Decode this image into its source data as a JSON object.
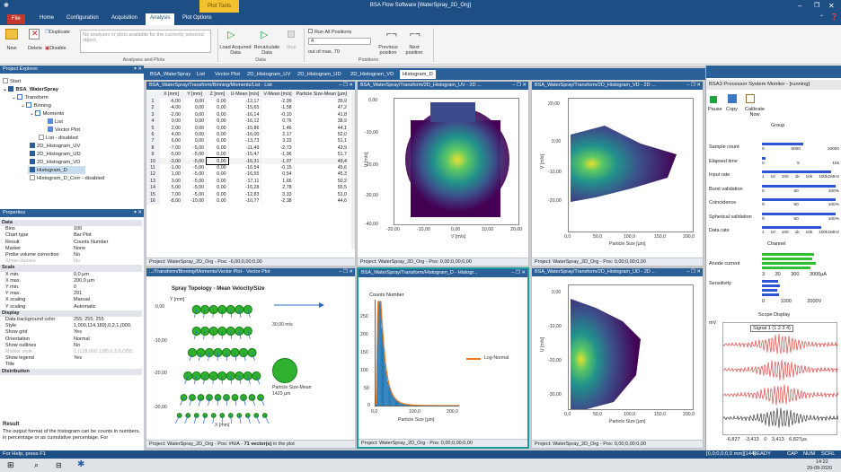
{
  "title": {
    "app": "BSA Flow Software [WaterSpray_2D_Org]",
    "context_tab": "Plot Tools"
  },
  "tabs": [
    "File",
    "Home",
    "Configuration",
    "Acquisition",
    "Analysis",
    "Plot Options"
  ],
  "ribbon": {
    "copy": "Copy",
    "duplicate": "Duplicate",
    "new": "New",
    "delete": "Delete",
    "disable": "Disable",
    "info": "No analyses or plots available for the currently selected object.",
    "group_analyses": "Analyses and Plots",
    "load": "Load Acquired Data",
    "recalc": "Recalculate Data",
    "stop": "Stop",
    "run_all": "Run All Positions",
    "position_value": "4",
    "out_of": "out of max. 70",
    "previous": "Previous position",
    "next": "Next position",
    "group_data": "Data",
    "group_positions": "Positions"
  },
  "explorer": {
    "title": "Project Explorer",
    "items": [
      "Start",
      "BSA_WaterSpray",
      "Transform",
      "Binning",
      "Moments",
      "List",
      "Vector Plot",
      "List - disabled",
      "2D_Histogram_UV",
      "2D_Histogram_UD",
      "2D_Histogram_VD",
      "Histogram_D",
      "Histogram_D_Corr - disabled"
    ]
  },
  "properties": {
    "title": "Properties",
    "rows": [
      {
        "c": 1,
        "k": "Data"
      },
      {
        "k": "Bins",
        "v": "100"
      },
      {
        "k": "Chart type",
        "v": "Bar Plot"
      },
      {
        "k": "Result",
        "v": "Counts Number"
      },
      {
        "k": "Marker",
        "v": "None"
      },
      {
        "k": "Probe volume correction",
        "v": "No"
      },
      {
        "d": 1,
        "k": "Show classes",
        "v": "No"
      },
      {
        "c": 1,
        "k": "Scale"
      },
      {
        "k": "X min.",
        "v": "0,0 µm"
      },
      {
        "k": "X max.",
        "v": "200,0 µm"
      },
      {
        "k": "Y min.",
        "v": "0"
      },
      {
        "k": "Y max.",
        "v": "291"
      },
      {
        "k": "X scaling",
        "v": "Manual"
      },
      {
        "k": "Y scaling",
        "v": "Automatic"
      },
      {
        "c": 1,
        "k": "Display"
      },
      {
        "k": "Data background color",
        "v": "255; 255; 255"
      },
      {
        "k": "Style",
        "v": "1,000,114,189),0,2,1,(000,"
      },
      {
        "k": "Show grid",
        "v": "Yes"
      },
      {
        "k": "Orientation",
        "v": "Normal"
      },
      {
        "k": "Show outlines",
        "v": "No"
      },
      {
        "d": 1,
        "k": "Marker style",
        "v": "1,(128,000,128),0,3,5,(255,"
      },
      {
        "k": "Show legend",
        "v": "Yes"
      },
      {
        "k": "Title",
        "v": ""
      },
      {
        "c": 1,
        "k": "Distribution"
      }
    ],
    "result_title": "Result",
    "result_text": "The output format of the histogram can be counts in numbers, in percentage or as cumulative percentage. For"
  },
  "doc_tabs": [
    "BSA_WaterSpray",
    "List",
    "Vector Plot",
    "2D_Histogram_UV",
    "2D_Histogram_UD",
    "2D_Histogram_VD",
    "Histogram_D"
  ],
  "list_pane": {
    "title": "BSA_WaterSpray/Transform/Binning/Moments/List - List",
    "headers": [
      "",
      "X [mm]",
      "Y [mm]",
      "Z [mm]",
      "U-Mean [m/s]",
      "V-Mean [m/s]",
      "Particle Size-Mean [µm]"
    ],
    "rows": [
      [
        "1",
        "-6,00",
        "0,00",
        "0,00",
        "-12,17",
        "-2,99",
        "39,9"
      ],
      [
        "2",
        "-4,00",
        "0,00",
        "0,00",
        "-15,65",
        "-1,58",
        "47,2"
      ],
      [
        "3",
        "-2,00",
        "0,00",
        "0,00",
        "-16,14",
        "-0,10",
        "41,8"
      ],
      [
        "4",
        "0,00",
        "0,00",
        "0,00",
        "-16,12",
        "0,76",
        "38,9"
      ],
      [
        "5",
        "2,00",
        "0,00",
        "0,00",
        "-15,86",
        "1,46",
        "44,1"
      ],
      [
        "6",
        "4,00",
        "0,00",
        "0,00",
        "-16,00",
        "2,17",
        "52,0"
      ],
      [
        "7",
        "6,00",
        "0,00",
        "0,00",
        "-13,73",
        "3,33",
        "51,1"
      ],
      [
        "8",
        "-7,00",
        "-5,00",
        "0,00",
        "-11,49",
        "-2,73",
        "43,9"
      ],
      [
        "9",
        "-5,00",
        "-5,00",
        "0,00",
        "-15,47",
        "-1,96",
        "51,7"
      ],
      [
        "10",
        "-3,00",
        "-5,00",
        "0,00",
        "-16,31",
        "-1,07",
        "49,4"
      ],
      [
        "11",
        "-1,00",
        "-5,00",
        "0,00",
        "-16,54",
        "-0,15",
        "45,6"
      ],
      [
        "12",
        "1,00",
        "-5,00",
        "0,00",
        "-16,55",
        "0,54",
        "45,3"
      ],
      [
        "13",
        "3,00",
        "-5,00",
        "0,00",
        "-17,11",
        "1,66",
        "50,2"
      ],
      [
        "14",
        "5,00",
        "-5,00",
        "0,00",
        "-16,28",
        "2,78",
        "55,5"
      ],
      [
        "15",
        "7,00",
        "-5,00",
        "0,00",
        "-12,83",
        "3,33",
        "51,0"
      ],
      [
        "16",
        "-8,00",
        "-10,00",
        "0,00",
        "-10,77",
        "-2,38",
        "44,6"
      ]
    ],
    "status": "Project: WaterSpray_2D_Org - Pos: -6,00;0,00;0,00"
  },
  "uv_pane": {
    "title": "BSA_WaterSpray/Transform/2D_Histogram_UV - 2D ...",
    "ylabel": "U [m/s]",
    "xlabel": "V [m/s]",
    "yticks": [
      "0,00",
      "-10,00",
      "-20,00",
      "-30,00",
      "-40,00"
    ],
    "xticks": [
      "-20,00",
      "-10,00",
      "0,00",
      "10,00",
      "20,00"
    ],
    "status": "Project: WaterSpray_2D_Org - Pos: 0,00;0,00;0,00"
  },
  "vd_pane": {
    "title": "BSA_WaterSpray/Transform/2D_Histogram_VD - 2D ...",
    "ylabel": "V [m/s]",
    "xlabel": "Particle Size [µm]",
    "yticks": [
      "20,00",
      "0,00",
      "-10,00",
      "-20,00"
    ],
    "xticks": [
      "0,0",
      "50,0",
      "100,0",
      "150,0",
      "200,0"
    ],
    "status": "Project: WaterSpray_2D_Org - Pos: 0,00;0,00;0,00"
  },
  "vector_pane": {
    "title": ".../Transform/Binning/Moments/Vector Plot - Vector Plot",
    "chart_title": "Spray Topology - Mean Velocity/Size",
    "ylabel": "Y [mm]",
    "yticks": [
      "0,00",
      "-10,00",
      "-20,00",
      "-30,00"
    ],
    "xlabel": "X [mm]",
    "ref_speed": "30,00 m/s",
    "size_label": "Particle Size-Mean",
    "size_value": "1420 µm",
    "status_prefix": "Project: WaterSpray_2D_Org - Pos: #N/A - ",
    "status_bold": "71 vector(s)",
    "status_suffix": " in the plot"
  },
  "hist_pane": {
    "title": "BSA_WaterSpray/Transform/Histogram_D - Histogr...",
    "chart_title": "Counts Number",
    "legend": "Log-Normal",
    "xlabel": "Particle Size [µm]",
    "yticks": [
      "250",
      "200",
      "150",
      "100",
      "50",
      "0"
    ],
    "xticks": [
      "0,0",
      "100,0",
      "200,0"
    ],
    "status": "Project: WaterSpray_2D_Org - Pos: 0,00;0,00;0,00"
  },
  "ud_pane": {
    "title": "BSA_WaterSpray/Transform/2D_Histogram_UD - 2D ...",
    "ylabel": "U [m/s]",
    "xlabel": "Particle Size [µm]",
    "yticks": [
      "0,00",
      "-10,00",
      "-20,00",
      "-30,00"
    ],
    "xticks": [
      "0,0",
      "50,0",
      "100,0",
      "150,0",
      "200,0"
    ],
    "status": "Project: WaterSpray_2D_Org - Pos: 0,00;0,00;0,00"
  },
  "monitor": {
    "title": "BSA3 Processor System Monitor - [running]",
    "pause": "Pause",
    "copy": "Copy",
    "calibrate": "Calibrate Now",
    "group": "Group",
    "channel": "Channel",
    "scope": "Scope Display",
    "signal": "Signal 1 (1 2 3 4)",
    "rows": [
      {
        "label": "Sample count",
        "ticks": [
          "0",
          "5000",
          "10000"
        ],
        "level": 0.55
      },
      {
        "label": "Elapsed time",
        "ticks": [
          "0",
          "5",
          "10s"
        ],
        "level": 0.05
      },
      {
        "label": "Input rate",
        "ticks": [
          "1",
          "10",
          "100",
          "1k",
          "10k",
          "100k1MHz"
        ],
        "level": 0.92
      },
      {
        "label": "Burst validation",
        "ticks": [
          "0",
          "50",
          "100%"
        ],
        "level": 0.98
      },
      {
        "label": "Coincidence",
        "ticks": [
          "0",
          "50",
          "100%"
        ],
        "level": 0.98
      },
      {
        "label": "Spherical validation",
        "ticks": [
          "0",
          "50",
          "100%"
        ],
        "level": 0.98
      },
      {
        "label": "Data rate",
        "ticks": [
          "1",
          "10",
          "100",
          "1k",
          "10k",
          "100k1MHz"
        ],
        "level": 0.78
      }
    ],
    "anode": "Anode current",
    "anode_ticks": [
      "3",
      "30",
      "300",
      "3000µA"
    ],
    "sensitivity": "Sensitivity",
    "sens_ticks": [
      "0",
      "1000",
      "2000V"
    ],
    "scope_ylabel": "mV",
    "scope_xticks": [
      "-6,827",
      "-3,413",
      "0",
      "3,413",
      "6,827µs"
    ]
  },
  "statusbar": {
    "help": "For Help, press F1",
    "coords": "[0,0;0,0;0,0 mm][144]",
    "ready": "READY",
    "cap": "CAP",
    "num": "NUM",
    "scrl": "SCRL"
  },
  "taskbar": {
    "time": "14:22",
    "date": "29-09-2020"
  },
  "colors": {
    "ribbon": "#1e4f84",
    "pane_header": "#2a5f98",
    "accent_teal": "#1a9a9a",
    "bar_blue": "#2f55d4"
  }
}
